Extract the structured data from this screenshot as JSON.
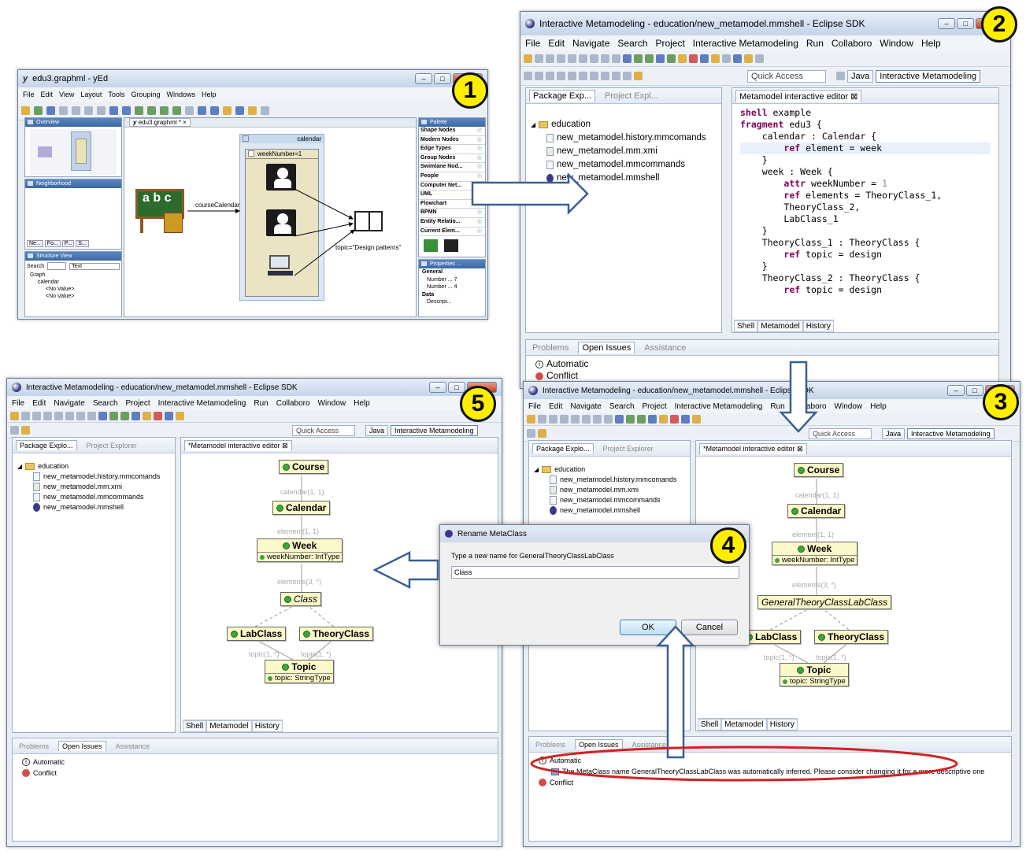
{
  "badges": [
    "1",
    "2",
    "3",
    "4",
    "5"
  ],
  "yed": {
    "title": "edu3.graphml - yEd",
    "menu": [
      "File",
      "Edit",
      "View",
      "Layout",
      "Tools",
      "Grouping",
      "Windows",
      "Help"
    ],
    "overview_title": "Overview",
    "neighborhood_title": "Neighborhood",
    "mini_tabs": [
      "Ne...",
      "Fo...",
      "P...",
      "S..."
    ],
    "structure_title": "Structure View",
    "search_label": "Search",
    "search_value": "Text",
    "tree": [
      "Graph",
      "calendar",
      "<No Value>",
      "<No Value>"
    ],
    "doc_tab": "edu3.graphml *",
    "group_label": "calendar",
    "inner_group_label": "weekNumber=1",
    "edge_label": "courseCalendar",
    "topic_label": "topic=\"Design patterns\"",
    "palette_title": "Palette",
    "palette_items": [
      "Shape Nodes",
      "Modern Nodes",
      "Edge Types",
      "Group Nodes",
      "Swimlane Nod...",
      "People",
      "Computer Net...",
      "UML",
      "Flowchart",
      "BPMN",
      "Entity Relatio...",
      "Current Elem..."
    ],
    "properties_title": "Properties ...",
    "props": [
      "General",
      "Number ... 7",
      "Number ... 4",
      "Data",
      "Descript..."
    ]
  },
  "eclipse2": {
    "title": "Interactive Metamodeling - education/new_metamodel.mmshell - Eclipse SDK",
    "menu": [
      "File",
      "Edit",
      "Navigate",
      "Search",
      "Project",
      "Interactive Metamodeling",
      "Run",
      "Collaboro",
      "Window",
      "Help"
    ],
    "quick_access": "Quick Access",
    "persp_java": "Java",
    "persp_im": "Interactive Metamodeling",
    "pkg_tab": "Package Exp...",
    "proj_tab": "Project Expl...",
    "project": "education",
    "files": [
      "new_metamodel.history.mmcomands",
      "new_metamodel.mm.xmi",
      "new_metamodel.mmcommands",
      "new_metamodel.mmshell"
    ],
    "editor_tab": "Metamodel interactive editor",
    "code": [
      [
        [
          "kw",
          "shell"
        ],
        [
          "",
          " example"
        ]
      ],
      [
        [
          "",
          ""
        ]
      ],
      [
        [
          "kw",
          "fragment"
        ],
        [
          "",
          " edu3 {"
        ]
      ],
      [
        [
          "",
          "    calendar : Calendar {"
        ]
      ],
      [
        [
          "",
          "        "
        ],
        [
          "kw",
          "ref"
        ],
        [
          "",
          " element = week"
        ]
      ],
      [
        [
          "",
          "    }"
        ]
      ],
      [
        [
          "",
          "    week : Week {"
        ]
      ],
      [
        [
          "",
          "        "
        ],
        [
          "kw",
          "attr"
        ],
        [
          "",
          " weekNumber = "
        ],
        [
          "num",
          "1"
        ]
      ],
      [
        [
          "",
          "        "
        ],
        [
          "kw",
          "ref"
        ],
        [
          "",
          " elements = TheoryClass_1,"
        ]
      ],
      [
        [
          "",
          "        TheoryClass_2,"
        ]
      ],
      [
        [
          "",
          "        LabClass_1"
        ]
      ],
      [
        [
          "",
          "    }"
        ]
      ],
      [
        [
          "",
          "    TheoryClass_1 : TheoryClass {"
        ]
      ],
      [
        [
          "",
          "        "
        ],
        [
          "kw",
          "ref"
        ],
        [
          "",
          " topic = design"
        ]
      ],
      [
        [
          "",
          "    }"
        ]
      ],
      [
        [
          "",
          "    TheoryClass_2 : TheoryClass {"
        ]
      ],
      [
        [
          "",
          "        "
        ],
        [
          "kw",
          "ref"
        ],
        [
          "",
          " topic = design"
        ]
      ]
    ],
    "bottom_tabs": [
      "Shell",
      "Metamodel",
      "History"
    ],
    "issue_tabs": [
      "Problems",
      "Open Issues",
      "Assistance"
    ],
    "issues": [
      "Automatic",
      "Conflict"
    ]
  },
  "eclipse3": {
    "title": "Interactive Metamodeling - education/new_metamodel.mmshell - Eclipse SDK",
    "menu": [
      "File",
      "Edit",
      "Navigate",
      "Search",
      "Project",
      "Interactive Metamodeling",
      "Run",
      "Collaboro",
      "Window",
      "Help"
    ],
    "quick_access": "Quick Access",
    "persp_java": "Java",
    "persp_im": "Interactive Metamodeling",
    "pkg_tab": "Package Explo...",
    "proj_tab": "Project Explorer",
    "project": "education",
    "files": [
      "new_metamodel.history.mmcomands",
      "new_metamodel.mm.xmi",
      "new_metamodel.mmcommands",
      "new_metamodel.mmshell"
    ],
    "editor_tab": "*Metamodel interactive editor",
    "bottom_tabs": [
      "Shell",
      "Metamodel",
      "History"
    ],
    "issue_tabs": [
      "Problems",
      "Open Issues",
      "Assistance"
    ],
    "issues": [
      "Automatic",
      "The MetaClass name GeneralTheoryClassLabClass was automatically inferred. Please consider changing it for a more descriptive one",
      "Conflict"
    ],
    "classes": {
      "course": "Course",
      "calendar": "Calendar",
      "week": "Week",
      "week_attr": "weekNumber: IntType",
      "general": "GeneralTheoryClassLabClass",
      "lab": "LabClass",
      "theory": "TheoryClass",
      "topic": "Topic",
      "topic_attr": "topic: StringType"
    },
    "edges": [
      "calendar(1, 1)",
      "element(1, 1)",
      "elements(3, *)",
      "topic(1, *)",
      "topic(1, *)"
    ]
  },
  "dialog": {
    "title": "Rename MetaClass",
    "prompt": "Type a new name for GeneralTheoryClassLabClass",
    "value": "Class",
    "ok": "OK",
    "cancel": "Cancel"
  },
  "eclipse5": {
    "title": "Interactive Metamodeling - education/new_metamodel.mmshell - Eclipse SDK",
    "menu": [
      "File",
      "Edit",
      "Navigate",
      "Search",
      "Project",
      "Interactive Metamodeling",
      "Run",
      "Collaboro",
      "Window",
      "Help"
    ],
    "quick_access": "Quick Access",
    "persp_java": "Java",
    "persp_im": "Interactive Metamodeling",
    "pkg_tab": "Package Explo...",
    "proj_tab": "Project Explorer",
    "project": "education",
    "files": [
      "new_metamodel.history.mmcomands",
      "new_metamodel.mm.xmi",
      "new_metamodel.mmcommands",
      "new_metamodel.mmshell"
    ],
    "editor_tab": "*Metamodel interactive editor",
    "bottom_tabs": [
      "Shell",
      "Metamodel",
      "History"
    ],
    "issue_tabs": [
      "Problems",
      "Open Issues",
      "Assistance"
    ],
    "issues": [
      "Automatic",
      "Conflict"
    ],
    "classes": {
      "course": "Course",
      "calendar": "Calendar",
      "week": "Week",
      "week_attr": "weekNumber: IntType",
      "general": "Class",
      "lab": "LabClass",
      "theory": "TheoryClass",
      "topic": "Topic",
      "topic_attr": "topic: StringType"
    },
    "edges": [
      "calendar(1, 1)",
      "element(1, 1)",
      "elements(3, *)",
      "topic(1, *)",
      "topic(1, *)"
    ]
  },
  "colors": {
    "badge": "#ffee00",
    "highlight_ellipse": "#d42020",
    "arrow": "#3a5f95",
    "metaclass_fill": "#fbf8c9"
  }
}
